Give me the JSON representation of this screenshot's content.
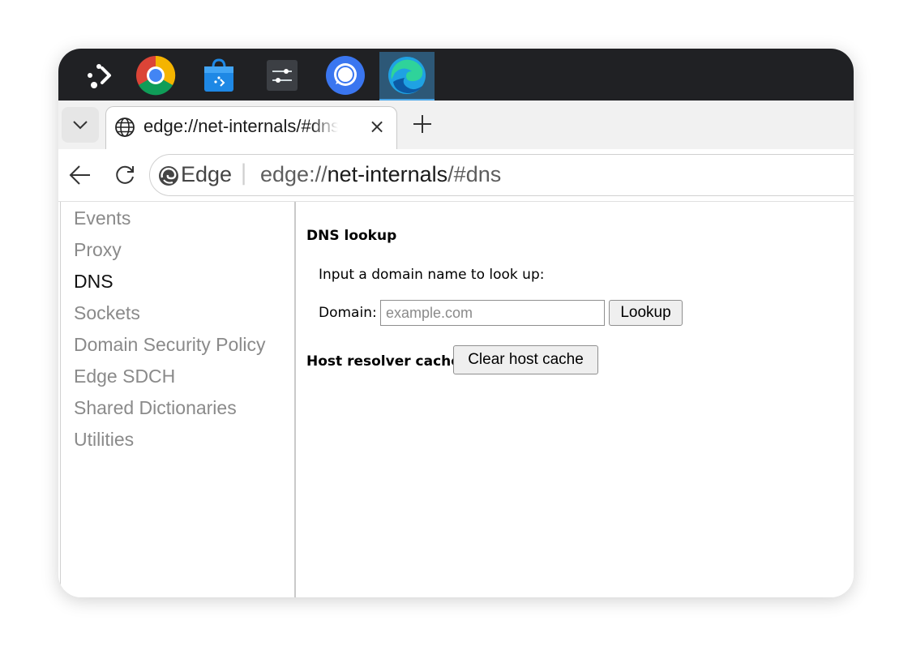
{
  "taskbar": {
    "apps": [
      {
        "icon": "app-launcher-icon",
        "active": false
      },
      {
        "icon": "chrome-icon",
        "active": false
      },
      {
        "icon": "store-icon",
        "active": false
      },
      {
        "icon": "settings-sliders-icon",
        "active": false
      },
      {
        "icon": "signal-icon",
        "active": false
      },
      {
        "icon": "edge-icon",
        "active": true
      }
    ]
  },
  "tabs": [
    {
      "title": "edge://net-internals/#dns",
      "icon": "globe-icon",
      "active": true
    }
  ],
  "toolbar": {
    "brand": "Edge",
    "separator": "|",
    "url_scheme": "edge://",
    "url_host": "net-internals",
    "url_path": "/#dns"
  },
  "sidebar": {
    "items": [
      {
        "label": "Events",
        "active": false
      },
      {
        "label": "Proxy",
        "active": false
      },
      {
        "label": "DNS",
        "active": true
      },
      {
        "label": "Sockets",
        "active": false
      },
      {
        "label": "Domain Security Policy",
        "active": false
      },
      {
        "label": "Edge SDCH",
        "active": false
      },
      {
        "label": "Shared Dictionaries",
        "active": false
      },
      {
        "label": "Utilities",
        "active": false
      }
    ]
  },
  "dns": {
    "heading": "DNS lookup",
    "prompt": "Input a domain name to look up:",
    "domain_label": "Domain:",
    "domain_value": "",
    "domain_placeholder": "example.com",
    "lookup_label": "Lookup",
    "cache_heading": "Host resolver cache",
    "clear_cache_label": "Clear host cache"
  },
  "colors": {
    "taskbar_bg": "#202124",
    "active_app_bg": "#2d5877",
    "active_app_indicator": "#4aa6e8",
    "tabstrip_bg": "#f1f1f1",
    "sidebar_inactive_text": "#8a8a8a"
  }
}
